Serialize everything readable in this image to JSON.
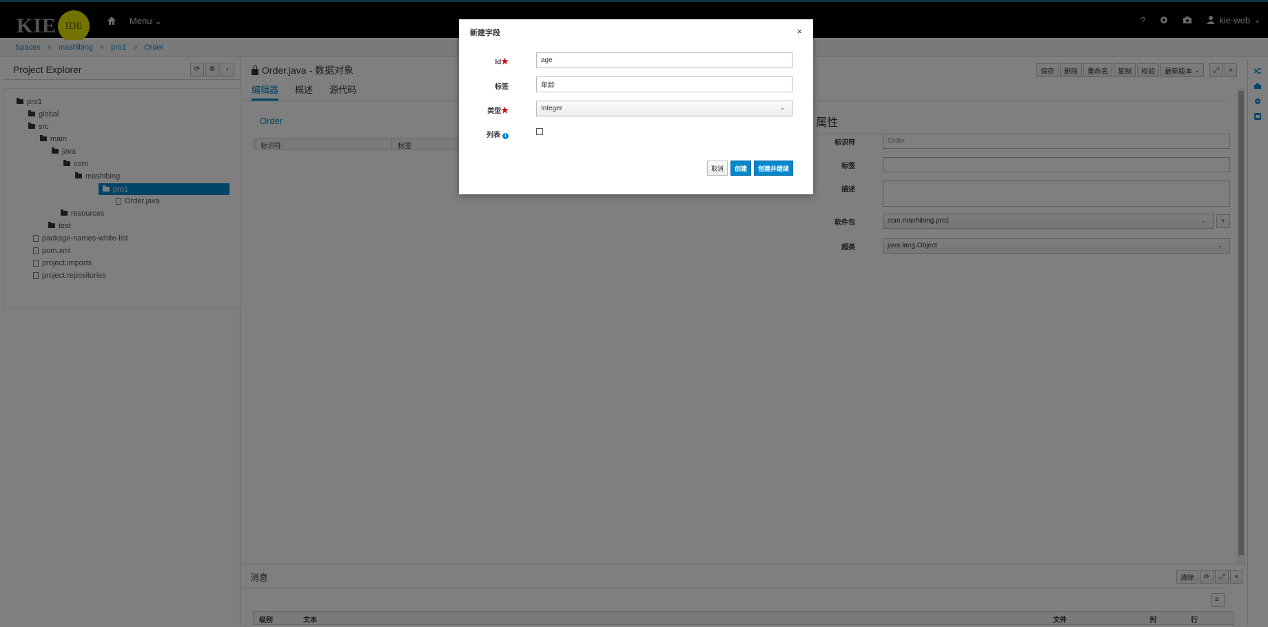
{
  "topbar": {
    "logo_kie": "KIE",
    "logo_ide": "IDE",
    "menu_label": "Menu",
    "help_label": "?",
    "user_label": "kie-web"
  },
  "breadcrumb": [
    "Spaces",
    "mashibing",
    "pro1",
    "Order"
  ],
  "explorer": {
    "title": "Project Explorer",
    "tree": [
      {
        "label": "pro1",
        "type": "folder"
      },
      {
        "label": "global",
        "type": "folder"
      },
      {
        "label": "src",
        "type": "folder"
      },
      {
        "label": "main",
        "type": "folder"
      },
      {
        "label": "java",
        "type": "folder"
      },
      {
        "label": "com",
        "type": "folder"
      },
      {
        "label": "mashibing",
        "type": "folder"
      },
      {
        "label": "pro1",
        "type": "folder",
        "selected": true
      },
      {
        "label": "Order.java",
        "type": "file"
      },
      {
        "label": "resources",
        "type": "folder"
      },
      {
        "label": "test",
        "type": "folder"
      },
      {
        "label": "package-names-white-list",
        "type": "file"
      },
      {
        "label": "pom.xml",
        "type": "file"
      },
      {
        "label": "project.imports",
        "type": "file"
      },
      {
        "label": "project.repositories",
        "type": "file"
      }
    ]
  },
  "editor": {
    "title": "Order.java - 数据对象",
    "toolbar": [
      "保存",
      "删除",
      "重命名",
      "复制",
      "校验",
      "最新版本"
    ],
    "tabs": [
      "编辑器",
      "概述",
      "源代码"
    ],
    "object_link": "Order",
    "table_headers": [
      "标识符",
      "标签"
    ],
    "properties": {
      "title": "属性",
      "identifier_label": "标识符",
      "identifier_value": "Order",
      "label_label": "标签",
      "description_label": "描述",
      "package_label": "软件包",
      "package_value": "com.mashibing.pro1",
      "superclass_label": "超类",
      "superclass_value": "java.lang.Object"
    }
  },
  "messages": {
    "title": "消息",
    "clear_label": "清除",
    "columns": [
      "级别",
      "文本",
      "文件",
      "列",
      "行"
    ]
  },
  "modal": {
    "title": "新建字段",
    "close": "×",
    "id_label": "Id",
    "id_value": "age",
    "label_label": "标签",
    "label_value": "年龄",
    "type_label": "类型",
    "type_value": "Integer",
    "list_label": "列表",
    "cancel": "取消",
    "create": "创建",
    "create_continue": "创建并继续"
  },
  "colors": {
    "accent": "#0088ce",
    "required": "#cc0000",
    "logo_yellow": "#e8e400"
  }
}
